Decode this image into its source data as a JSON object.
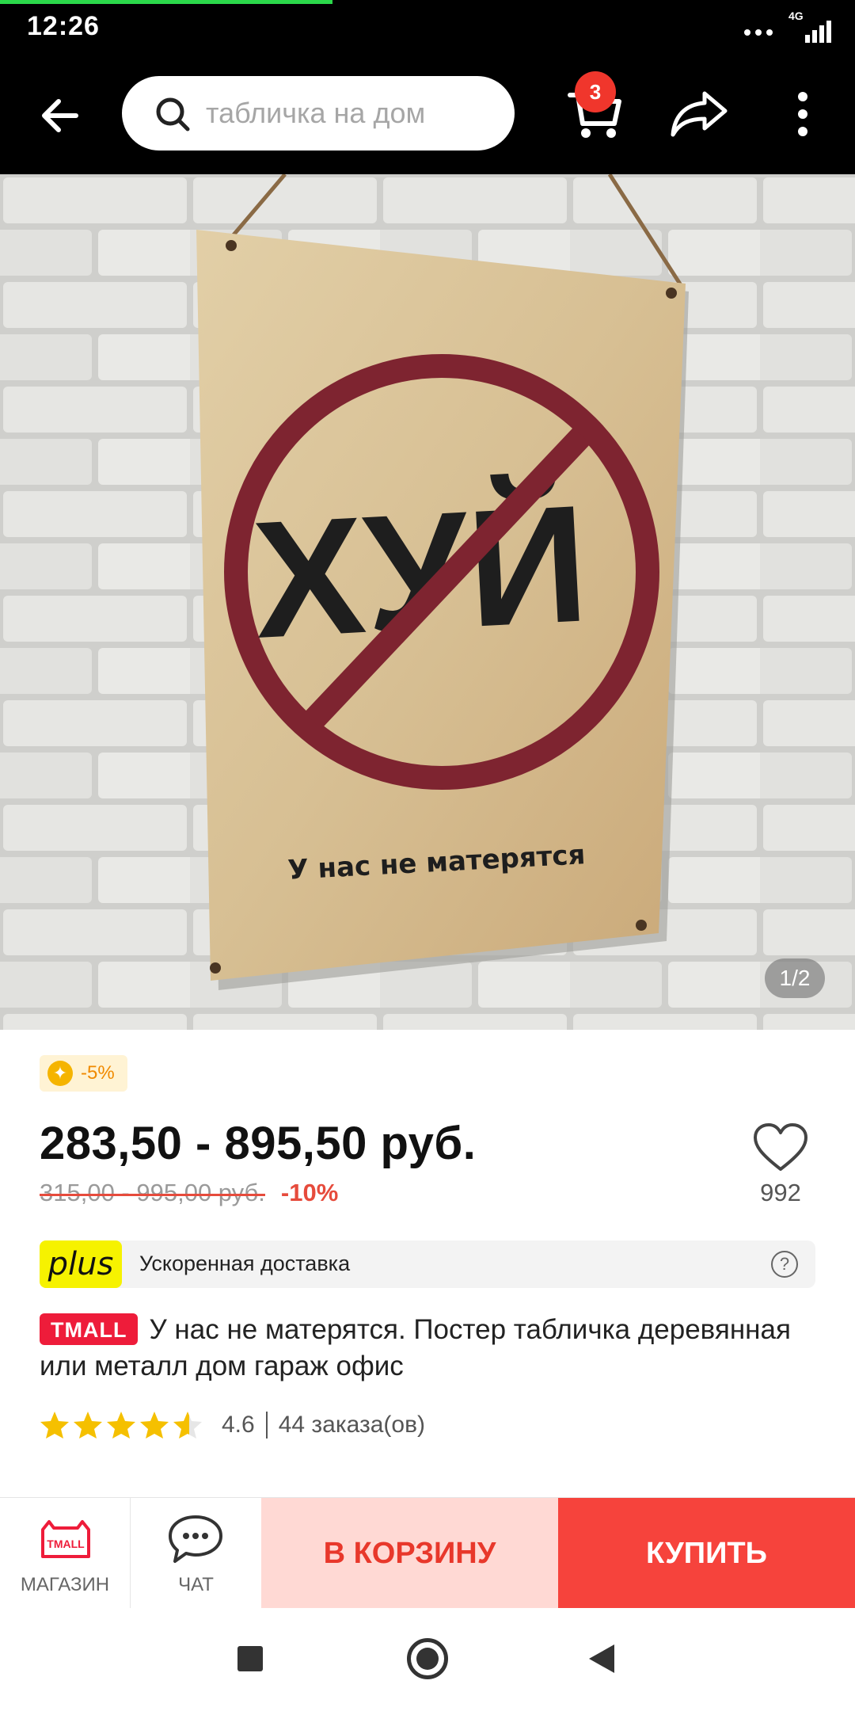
{
  "status_bar": {
    "time": "12:26",
    "network": "4G"
  },
  "search": {
    "placeholder": "табличка на дом"
  },
  "cart": {
    "count": "3"
  },
  "product_image": {
    "sign_main_text": "ХУЙ",
    "sign_caption": "У нас не матерятся",
    "counter": "1/2"
  },
  "promo": {
    "label": "-5%"
  },
  "price": {
    "current": "283,50 - 895,50 руб.",
    "old": "315,00 - 995,00 руб.",
    "discount": "-10%"
  },
  "wishlist": {
    "count": "992"
  },
  "delivery": {
    "logo": "plus",
    "label": "Ускоренная доставка"
  },
  "title": {
    "badge": "TMALL",
    "text": "У нас не матерятся. Постер табличка деревянная или металл  дом гараж офис"
  },
  "rating": {
    "value": "4.6",
    "orders": "44 заказа(ов)",
    "stars": 4.5
  },
  "actions": {
    "shop_label": "МАГАЗИН",
    "chat_label": "ЧАТ",
    "add_to_cart": "В КОРЗИНУ",
    "buy": "КУПИТЬ",
    "shop_icon_text": "TMALL"
  },
  "colors": {
    "accent_red": "#f6433c",
    "cart_button_bg": "#ffd9d4",
    "tmall_red": "#ee1c3a",
    "plus_yellow": "#f6f200",
    "progress_green": "#2bd84a"
  }
}
